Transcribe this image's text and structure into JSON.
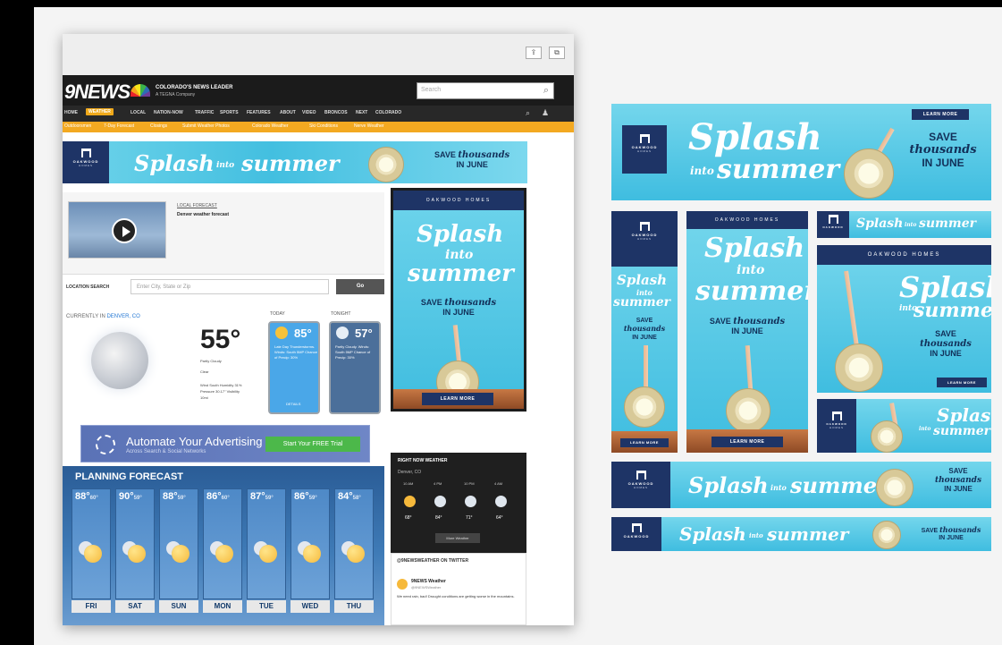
{
  "site": {
    "logo": "9NEWS",
    "tagline": "COLORADO'S NEWS LEADER",
    "tagline2": "A TEGNA Company",
    "search_placeholder": "Search",
    "nav": [
      "HOME",
      "WEATHER",
      "LOCAL",
      "NATION-NOW",
      "TRAFFIC",
      "SPORTS",
      "FEATURES",
      "ABOUT",
      "VIDEO",
      "BRONCOS",
      "NEXT",
      "COLORADO"
    ],
    "subnav": [
      "Outdoorsmen",
      "7-Day Forecast",
      "Closings",
      "Submit Weather Photos",
      "Colorado Weather",
      "Ski Conditions",
      "Nerve Weather"
    ]
  },
  "local_forecast": {
    "label": "LOCAL FORECAST",
    "title": "Denver weather forecast"
  },
  "location": {
    "label": "LOCATION SEARCH",
    "placeholder": "Enter City, State or Zip",
    "go": "Go"
  },
  "current": {
    "label": "CURRENTLY IN",
    "city": "DENVER, CO",
    "temp": "55°",
    "cond1": "Partly Cloudy",
    "cond2": "Clear",
    "details": "Wind South  Humidity 31%  Pressure 30.17\"  Visibility 10mi"
  },
  "today": {
    "label": "TODAY",
    "temp": "85°",
    "text": "Late Day Thunderstorms. Winds: South 5MP Chance of Precip: 30%",
    "details": "DETAILS"
  },
  "tonight": {
    "label": "TONIGHT",
    "temp": "57°",
    "text": "Partly Cloudy. Winds: South 5MP Chance of Precip: 30%"
  },
  "ad2": {
    "text": "Automate Your Advertising",
    "sub": "Across Search & Social Networks",
    "button": "Start Your FREE Trial"
  },
  "planning": {
    "title": "PLANNING FORECAST",
    "days": [
      {
        "hi": "88°",
        "lo": "60°",
        "name": "FRI"
      },
      {
        "hi": "90°",
        "lo": "59°",
        "name": "SAT"
      },
      {
        "hi": "88°",
        "lo": "59°",
        "name": "SUN"
      },
      {
        "hi": "86°",
        "lo": "60°",
        "name": "MON"
      },
      {
        "hi": "87°",
        "lo": "59°",
        "name": "TUE"
      },
      {
        "hi": "86°",
        "lo": "59°",
        "name": "WED"
      },
      {
        "hi": "84°",
        "lo": "58°",
        "name": "THU"
      }
    ]
  },
  "right_now": {
    "title": "RIGHT NOW WEATHER",
    "location": "Denver, CO",
    "times": [
      "10 AM",
      "4 PM",
      "10 PM",
      "4 AM"
    ],
    "temps": [
      "68°",
      "84°",
      "71°",
      "64°"
    ],
    "button": "More Weather"
  },
  "twitter": {
    "title": "@9NEWSWEATHER ON TWITTER",
    "name": "9NEWS Weather",
    "handle": "@9NEWSWeather",
    "text": "We need rain, bad! Drought conditions are getting worse in the mountains."
  },
  "ad": {
    "brand": "OAKWOOD",
    "brand2": "HOMES",
    "brand_full": "OAKWOOD HOMES",
    "splash": "Splash",
    "into": "into",
    "summer": "summer",
    "save": "SAVE",
    "thousands": "thousands",
    "in_june": "IN JUNE",
    "learn_more": "LEARN MORE"
  }
}
